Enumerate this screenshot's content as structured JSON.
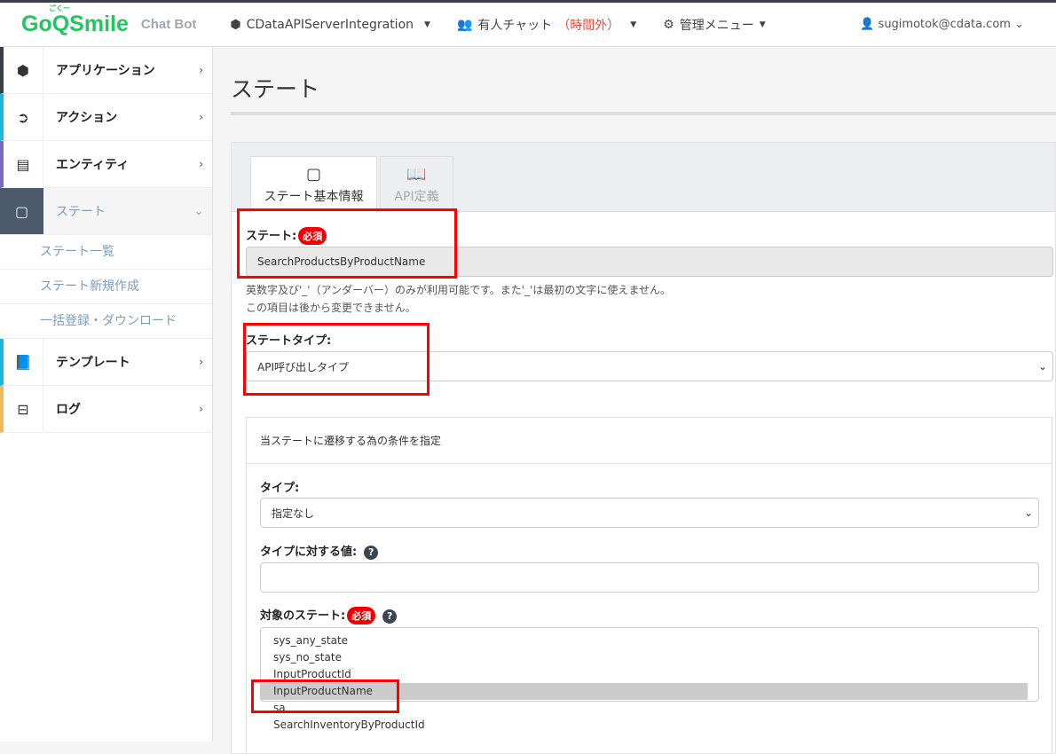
{
  "header": {
    "logo": "GoQSmile",
    "logo_ruby": "ごくー",
    "product": "Chat Bot",
    "app": "CDataAPIServerIntegration",
    "chat": "有人チャット",
    "chat_status": "（時間外）",
    "admin": "管理メニュー",
    "user": "sugimotok@cdata.com"
  },
  "sidebar": {
    "items": [
      {
        "label": "アプリケーション",
        "icon": "cube-icon",
        "color": "#3a3f47"
      },
      {
        "label": "アクション",
        "icon": "arrow-circle-icon",
        "color": "#1fb5e0"
      },
      {
        "label": "エンティティ",
        "icon": "list-icon",
        "color": "#7b68c1"
      },
      {
        "label": "ステート",
        "icon": "square-icon"
      },
      {
        "label": "テンプレート",
        "icon": "book-icon",
        "color": "#1fb5e0"
      },
      {
        "label": "ログ",
        "icon": "inbox-icon",
        "color": "#f0b95f"
      }
    ],
    "subitems": [
      "ステート一覧",
      "ステート新規作成",
      "一括登録・ダウンロード"
    ]
  },
  "main": {
    "title": "ステート",
    "tabs": [
      "ステート基本情報",
      "API定義"
    ],
    "state_label": "ステート:",
    "required": "必須",
    "state_value": "SearchProductsByProductName",
    "help1": "英数字及び'_'（アンダーバー）のみが利用可能です。また'_'は最初の文字に使えません。",
    "help2": "この項目は後から変更できません。",
    "type_label": "ステートタイプ:",
    "type_value": "API呼び出しタイプ",
    "cond_header": "当ステートに遷移する為の条件を指定",
    "ctype_label": "タイプ:",
    "ctype_value": "指定なし",
    "cvalue_label": "タイプに対する値:",
    "cvalue": "",
    "target_label": "対象のステート:",
    "targets": [
      "sys_any_state",
      "sys_no_state",
      "InputProductId",
      "InputProductName",
      "sa",
      "SearchInventoryByProductId"
    ]
  }
}
